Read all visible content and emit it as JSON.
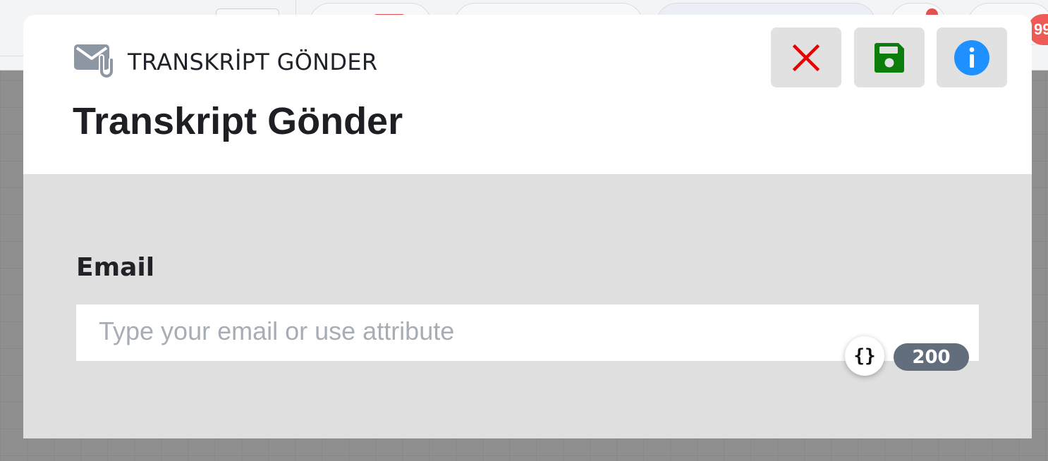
{
  "background": {
    "notification_count": "99"
  },
  "modal": {
    "node_type_label": "TRANSKRİPT GÖNDER",
    "title": "Transkript Gönder",
    "header_icon": "mail-attachment-icon",
    "actions": {
      "close_icon": "close-icon",
      "save_icon": "save-icon",
      "info_icon": "info-icon"
    },
    "colors": {
      "close": "#e60000",
      "save": "#0a7d0a",
      "info": "#1e90ff",
      "icon_gray": "#8d96a3"
    },
    "email_field": {
      "label": "Email",
      "value": "",
      "placeholder": "Type your email or use attribute",
      "attribute_icon": "curly-braces-icon",
      "char_limit": "200"
    }
  }
}
